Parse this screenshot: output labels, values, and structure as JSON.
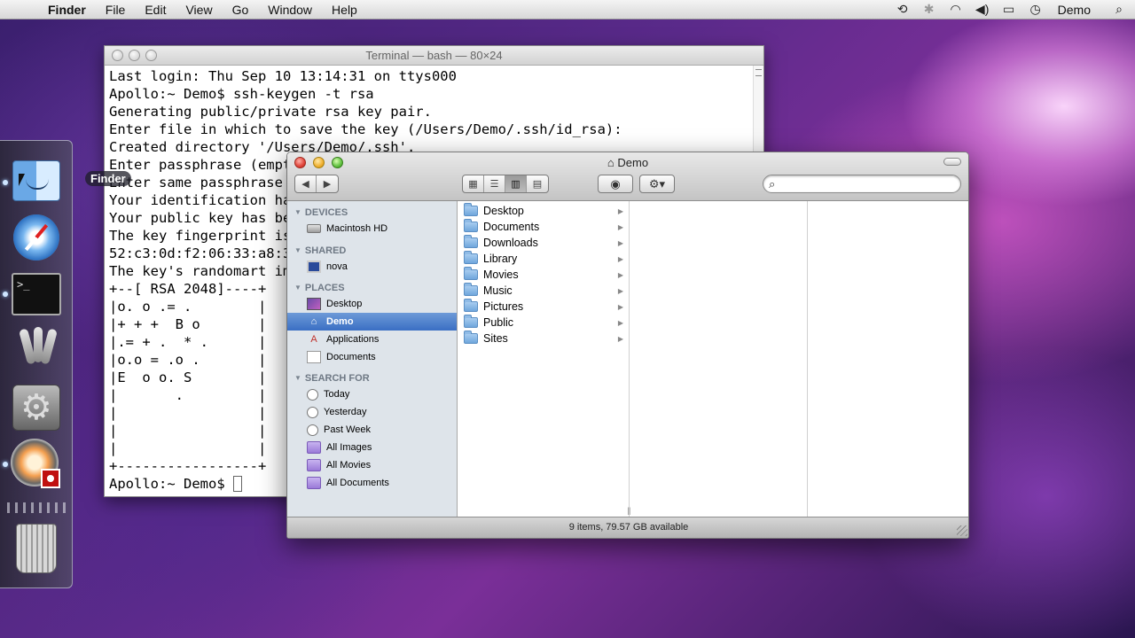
{
  "menubar": {
    "app_name": "Finder",
    "items": [
      "File",
      "Edit",
      "View",
      "Go",
      "Window",
      "Help"
    ],
    "status_icons": [
      "time-machine-icon",
      "bluetooth-icon",
      "wifi-icon",
      "volume-icon",
      "battery-icon",
      "clock-icon"
    ],
    "user": "Demo"
  },
  "dock": {
    "tooltip": "Finder",
    "apps": [
      "finder-icon",
      "safari-icon",
      "terminal-icon",
      "keychain-icon",
      "system-preferences-icon",
      "screen-recorder-icon",
      "trash-icon"
    ],
    "terminal_icon_text": ">_"
  },
  "terminal": {
    "title": "Terminal — bash — 80×24",
    "lines": [
      "Last login: Thu Sep 10 13:14:31 on ttys000",
      "Apollo:~ Demo$ ssh-keygen -t rsa",
      "Generating public/private rsa key pair.",
      "Enter file in which to save the key (/Users/Demo/.ssh/id_rsa):",
      "Created directory '/Users/Demo/.ssh'.",
      "Enter passphrase (empty",
      "Enter same passphrase a",
      "Your identification has",
      "Your public key has bee",
      "The key fingerprint is:",
      "52:c3:0d:f2:06:33:a8:37",
      "The key's randomart ima",
      "+--[ RSA 2048]----+",
      "|o. o .= .        |",
      "|+ + +  B o       |",
      "|.= + .  * .      |",
      "|o.o = .o .       |",
      "|E  o o. S        |",
      "|       .         |",
      "|                 |",
      "|                 |",
      "|                 |",
      "+-----------------+",
      "Apollo:~ Demo$ "
    ]
  },
  "finder": {
    "title": "Demo",
    "sidebar": {
      "sections": [
        {
          "name": "DEVICES",
          "items": [
            {
              "label": "Macintosh HD",
              "icon": "hard-drive-icon"
            }
          ]
        },
        {
          "name": "SHARED",
          "items": [
            {
              "label": "nova",
              "icon": "monitor-icon"
            }
          ]
        },
        {
          "name": "PLACES",
          "items": [
            {
              "label": "Desktop",
              "icon": "desktop-icon"
            },
            {
              "label": "Demo",
              "icon": "home-icon",
              "selected": true
            },
            {
              "label": "Applications",
              "icon": "applications-icon"
            },
            {
              "label": "Documents",
              "icon": "documents-icon"
            }
          ]
        },
        {
          "name": "SEARCH FOR",
          "items": [
            {
              "label": "Today",
              "icon": "clock-icon"
            },
            {
              "label": "Yesterday",
              "icon": "clock-icon"
            },
            {
              "label": "Past Week",
              "icon": "clock-icon"
            },
            {
              "label": "All Images",
              "icon": "smart-folder-icon"
            },
            {
              "label": "All Movies",
              "icon": "smart-folder-icon"
            },
            {
              "label": "All Documents",
              "icon": "smart-folder-icon"
            }
          ]
        }
      ]
    },
    "column1": [
      "Desktop",
      "Documents",
      "Downloads",
      "Library",
      "Movies",
      "Music",
      "Pictures",
      "Public",
      "Sites"
    ],
    "status": "9 items, 79.57 GB available",
    "search_placeholder": ""
  }
}
